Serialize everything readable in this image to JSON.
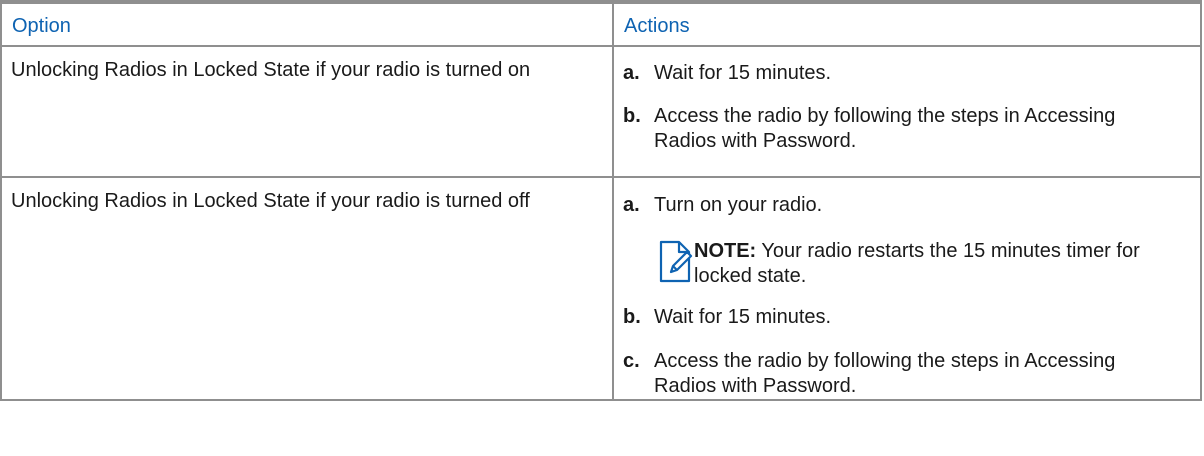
{
  "table": {
    "headers": {
      "option": "Option",
      "actions": "Actions"
    },
    "rows": [
      {
        "option": "Unlocking Radios in Locked State if your radio is turned on",
        "steps": [
          {
            "letter": "a.",
            "text": "Wait for 15 minutes."
          },
          {
            "letter": "b.",
            "text": "Access the radio by following the steps in Accessing Radios with Password."
          }
        ]
      },
      {
        "option": "Unlocking Radios in Locked State if your radio is turned off",
        "steps": [
          {
            "letter": "a.",
            "text": "Turn on your radio."
          },
          {
            "letter": "b.",
            "text": "Wait for 15 minutes."
          },
          {
            "letter": "c.",
            "text": "Access the radio by following the steps in Accessing Radios with Password."
          }
        ],
        "note": {
          "label": "NOTE:",
          "text": "Your radio restarts the 15 minutes timer for locked state.",
          "icon": "note-icon"
        }
      }
    ]
  },
  "colors": {
    "header_text": "#0e63b2",
    "border": "#8f8f8f",
    "note_icon": "#0e63b2"
  }
}
